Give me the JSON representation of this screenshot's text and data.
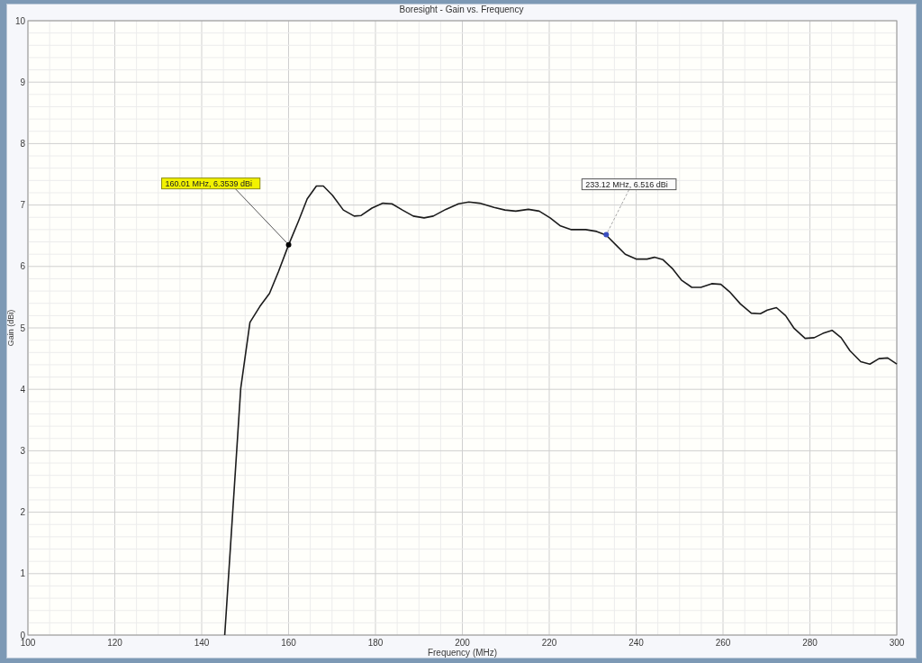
{
  "chart": {
    "chart_data": {
      "type": "line",
      "title": "Boresight - Gain vs. Frequency",
      "xlabel": "Frequency (MHz)",
      "ylabel": "Gain (dBi)",
      "x": [
        145.3,
        149.0,
        151.1,
        153.4,
        155.6,
        157.7,
        160.0,
        162.3,
        164.3,
        166.4,
        168.0,
        170.1,
        172.6,
        175.1,
        176.7,
        179.2,
        181.7,
        183.8,
        186.2,
        188.7,
        191.2,
        193.3,
        196.2,
        199.1,
        201.5,
        204.0,
        207.3,
        209.8,
        212.3,
        215.2,
        217.7,
        220.2,
        222.6,
        225.1,
        228.4,
        230.9,
        233.1,
        235.5,
        237.5,
        240.0,
        242.5,
        244.2,
        246.2,
        248.3,
        250.4,
        252.8,
        254.9,
        257.4,
        259.5,
        261.5,
        264.0,
        266.5,
        268.6,
        270.2,
        272.3,
        274.4,
        276.4,
        278.9,
        281.0,
        283.0,
        285.1,
        287.2,
        289.2,
        291.7,
        293.8,
        295.9,
        297.9,
        300.0
      ],
      "values": [
        0,
        4.02,
        5.09,
        5.35,
        5.56,
        5.92,
        6.35,
        6.74,
        7.1,
        7.31,
        7.31,
        7.16,
        6.92,
        6.82,
        6.83,
        6.95,
        7.03,
        7.02,
        6.92,
        6.82,
        6.79,
        6.82,
        6.93,
        7.02,
        7.05,
        7.03,
        6.96,
        6.92,
        6.9,
        6.93,
        6.9,
        6.79,
        6.66,
        6.6,
        6.6,
        6.57,
        6.51,
        6.34,
        6.2,
        6.12,
        6.12,
        6.15,
        6.11,
        5.97,
        5.78,
        5.66,
        5.66,
        5.72,
        5.71,
        5.59,
        5.39,
        5.24,
        5.23,
        5.29,
        5.33,
        5.2,
        4.99,
        4.83,
        4.84,
        4.91,
        4.96,
        4.84,
        4.63,
        4.45,
        4.41,
        4.5,
        4.51,
        4.41
      ],
      "xlim": [
        100,
        300
      ],
      "ylim": [
        0,
        10
      ],
      "xticks": [
        100,
        120,
        140,
        160,
        180,
        200,
        220,
        240,
        260,
        280,
        300
      ],
      "yticks": [
        0,
        1,
        2,
        3,
        4,
        5,
        6,
        7,
        8,
        9,
        10
      ],
      "grid": true,
      "annotations": [
        {
          "x": 160.01,
          "y": 6.3539,
          "text": "160.01 MHz, 6.3539 dBi"
        },
        {
          "x": 233.12,
          "y": 6.516,
          "text": "233.12 MHz, 6.516 dBi"
        }
      ]
    }
  }
}
